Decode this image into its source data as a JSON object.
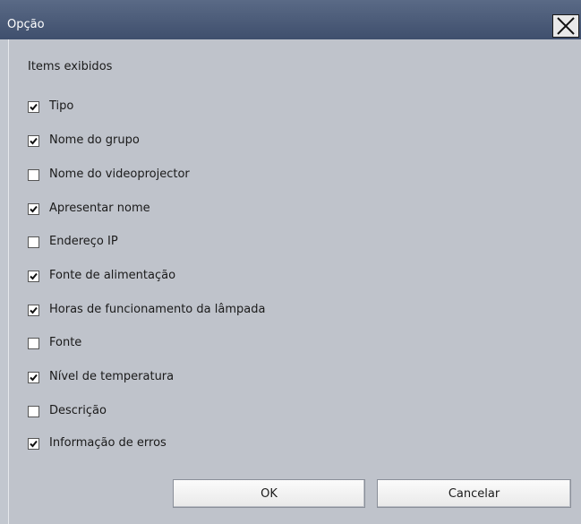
{
  "window": {
    "title": "Opção",
    "close_icon": "close-icon"
  },
  "group": {
    "label": "Items exibidos"
  },
  "items": [
    {
      "label": "Tipo",
      "checked": true
    },
    {
      "label": "Nome do grupo",
      "checked": true
    },
    {
      "label": "Nome do videoprojector",
      "checked": false
    },
    {
      "label": "Apresentar nome",
      "checked": true
    },
    {
      "label": "Endereço IP",
      "checked": false
    },
    {
      "label": "Fonte de alimentação",
      "checked": true
    },
    {
      "label": "Horas de funcionamento da lâmpada",
      "checked": true
    },
    {
      "label": "Fonte",
      "checked": false
    },
    {
      "label": "Nível de temperatura",
      "checked": true
    },
    {
      "label": "Descrição",
      "checked": false
    },
    {
      "label": "Informação de erros",
      "checked": true
    }
  ],
  "buttons": {
    "ok": "OK",
    "cancel": "Cancelar"
  }
}
